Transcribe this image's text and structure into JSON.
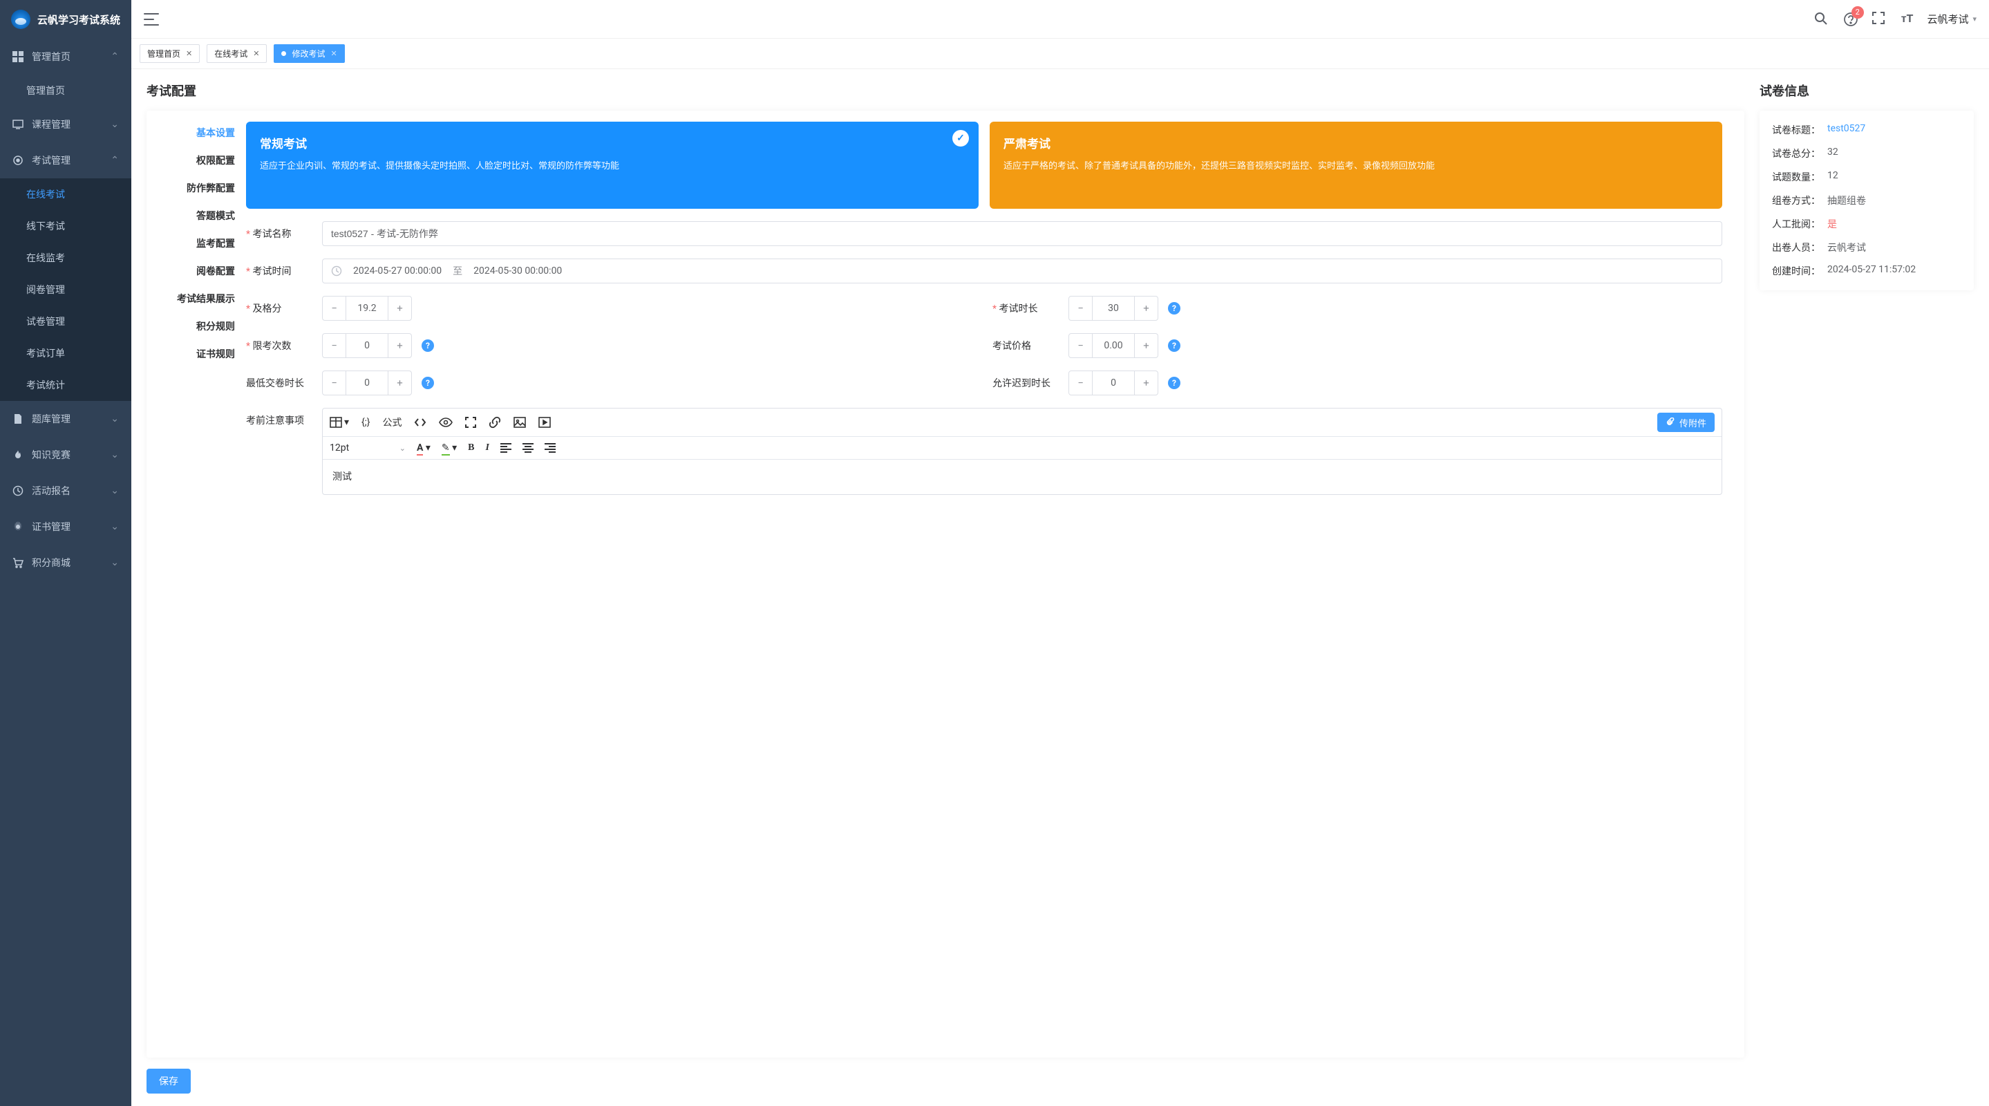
{
  "brand": {
    "name": "云帆学习考试系统"
  },
  "sidebar": {
    "items": [
      {
        "label": "管理首页"
      },
      {
        "label": "管理首页"
      },
      {
        "label": "课程管理"
      },
      {
        "label": "考试管理"
      },
      {
        "label": "在线考试"
      },
      {
        "label": "线下考试"
      },
      {
        "label": "在线监考"
      },
      {
        "label": "阅卷管理"
      },
      {
        "label": "试卷管理"
      },
      {
        "label": "考试订单"
      },
      {
        "label": "考试统计"
      },
      {
        "label": "题库管理"
      },
      {
        "label": "知识竞赛"
      },
      {
        "label": "活动报名"
      },
      {
        "label": "证书管理"
      },
      {
        "label": "积分商城"
      }
    ]
  },
  "topbar": {
    "badge_count": "2",
    "user_name": "云帆考试"
  },
  "tabs": [
    {
      "label": "管理首页"
    },
    {
      "label": "在线考试"
    },
    {
      "label": "修改考试"
    }
  ],
  "section_title": "考试配置",
  "settings_nav": [
    "基本设置",
    "权限配置",
    "防作弊配置",
    "答题模式",
    "监考配置",
    "阅卷配置",
    "考试结果展示",
    "积分规则",
    "证书规则"
  ],
  "exam_types": {
    "normal": {
      "title": "常规考试",
      "desc": "适应于企业内训、常规的考试、提供摄像头定时拍照、人脸定时比对、常规的防作弊等功能"
    },
    "strict": {
      "title": "严肃考试",
      "desc": "适应于严格的考试、除了普通考试具备的功能外，还提供三路音视频实时监控、实时监考、录像视频回放功能"
    }
  },
  "form": {
    "exam_name_label": "考试名称",
    "exam_name_value": "test0527 - 考试-无防作弊",
    "exam_time_label": "考试时间",
    "exam_time_start": "2024-05-27 00:00:00",
    "exam_time_sep": "至",
    "exam_time_end": "2024-05-30 00:00:00",
    "pass_label": "及格分",
    "pass_value": "19.2",
    "duration_label": "考试时长",
    "duration_value": "30",
    "limit_label": "限考次数",
    "limit_value": "0",
    "price_label": "考试价格",
    "price_value": "0.00",
    "min_submit_label": "最低交卷时长",
    "min_submit_value": "0",
    "late_label": "允许迟到时长",
    "late_value": "0",
    "notice_label": "考前注意事项",
    "upload_label": "传附件",
    "font_size": "12pt",
    "formula_label": "公式",
    "editor_content": "测试"
  },
  "save_label": "保存",
  "info": {
    "title": "试卷信息",
    "paper_title_k": "试卷标题：",
    "paper_title_v": "test0527",
    "score_k": "试卷总分：",
    "score_v": "32",
    "qcount_k": "试题数量：",
    "qcount_v": "12",
    "method_k": "组卷方式：",
    "method_v": "抽题组卷",
    "manual_k": "人工批阅：",
    "manual_v": "是",
    "author_k": "出卷人员：",
    "author_v": "云帆考试",
    "created_k": "创建时间：",
    "created_v": "2024-05-27 11:57:02"
  }
}
